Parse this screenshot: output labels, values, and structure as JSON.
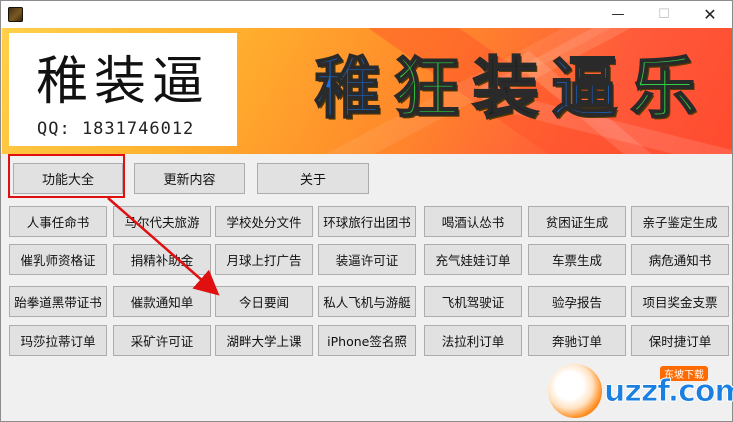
{
  "window": {
    "min_glyph": "—",
    "max_glyph": "☐",
    "close_glyph": "✕"
  },
  "banner": {
    "logo_title": "稚装逼",
    "qq_label": "QQ: 1831746012",
    "slogan": [
      "稚",
      "狂",
      "装",
      "逼",
      "乐"
    ],
    "slogan_colors": [
      "#1a6fe0",
      "#2fd040",
      "#1c1c1c",
      "#1a6fe0",
      "#2fd040"
    ]
  },
  "tabs": [
    "功能大全",
    "更新内容",
    "关于"
  ],
  "grid": [
    [
      "人事任命书",
      "马尔代夫旅游",
      "学校处分文件",
      "环球旅行出团书",
      "喝酒认怂书",
      "贫困证生成",
      "亲子鉴定生成"
    ],
    [
      "催乳师资格证",
      "捐精补助金",
      "月球上打广告",
      "装逼许可证",
      "充气娃娃订单",
      "车票生成",
      "病危通知书"
    ],
    [
      "跆拳道黑带证书",
      "催款通知单",
      "今日要闻",
      "私人飞机与游艇",
      "飞机驾驶证",
      "验孕报告",
      "项目奖金支票"
    ],
    [
      "玛莎拉蒂订单",
      "采矿许可证",
      "湖畔大学上课",
      "iPhone签名照",
      "法拉利订单",
      "奔驰订单",
      "保时捷订单"
    ]
  ],
  "watermark": {
    "brand": "uzzf.com",
    "tag": "东坡下载"
  },
  "colors": {
    "highlight": "#e01010",
    "arrow": "#e01010"
  }
}
